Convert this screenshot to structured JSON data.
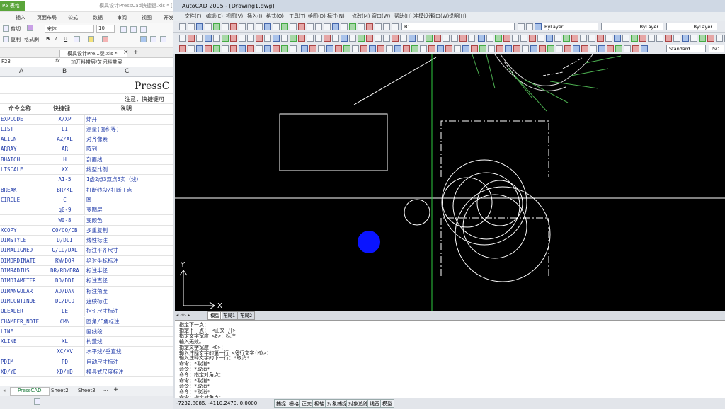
{
  "spreadsheet": {
    "app_label": "P5 表格",
    "doc_title": "模具设计PressCad快捷键.xls * [",
    "ribbon_tabs": [
      "插入",
      "页面布局",
      "公式",
      "数据",
      "审阅",
      "视图",
      "开发"
    ],
    "ribbon": {
      "cut": "剪切",
      "copy": "复制",
      "format_painter": "格式刷",
      "font": "宋体",
      "size": "10",
      "bold": "B",
      "italic": "I",
      "underline": "U"
    },
    "file_tab": "模具设计Pre...键.xls *",
    "cell_ref": "F23",
    "fx": "fx",
    "formula": "加开料带层/关闭料带层",
    "columns": [
      "A",
      "B",
      "C"
    ],
    "title": "PressC",
    "note": "注意，快捷键可",
    "header": [
      "命令全称",
      "快捷键",
      "说明"
    ],
    "rows": [
      [
        "EXPLODE",
        "X/XP",
        "炸开"
      ],
      [
        "LIST",
        "LI",
        "测量(面积等)"
      ],
      [
        "ALIGN",
        "AZ/AL",
        "对齐像素"
      ],
      [
        "ARRAY",
        "AR",
        "阵列"
      ],
      [
        "BHATCH",
        "H",
        "剖面线"
      ],
      [
        "LTSCALE",
        "XX",
        "线型比例"
      ],
      [
        "",
        "A1-5",
        "1虚2点3双点5实（线）"
      ],
      [
        "BREAK",
        "BR/KL",
        "打断线段/打断于点"
      ],
      [
        "CIRCLE",
        "C",
        "圆"
      ],
      [
        "",
        "q0-9",
        "变图层"
      ],
      [
        "",
        "W0-8",
        "变颜色"
      ],
      [
        "XCOPY",
        "CO/CQ/CB",
        "多重复制"
      ],
      [
        "DIMSTYLE",
        "D/DLI",
        "线性标注"
      ],
      [
        "DIMALIGNED",
        "G/LD/DAL",
        "标注平齐尺寸"
      ],
      [
        "DIMORDINATE",
        "RW/DOR",
        "绝对坐标标注"
      ],
      [
        "DIMRADIUS",
        "DR/RD/DRA",
        "标注半径"
      ],
      [
        "DIMDIAMETER",
        "DD/DDI",
        "标注直径"
      ],
      [
        "DIMANGULAR",
        "AD/DAN",
        "标注角度"
      ],
      [
        "DIMCONTINUE",
        "DC/DCO",
        "连续标注"
      ],
      [
        "QLEADER",
        "LE",
        "指引尺寸标注"
      ],
      [
        "CHAMFER_NOTE",
        "CMN",
        "圆角/C角标注"
      ],
      [
        "LINE",
        "L",
        "画线段"
      ],
      [
        "XLINE",
        "XL",
        "构造线"
      ],
      [
        "",
        "XC/XV",
        "水平线/垂直线"
      ],
      [
        "PDIM",
        "PD",
        "自动尺寸标注"
      ],
      [
        "XD/YD",
        "XD/YD",
        "模具式尺度标注"
      ]
    ],
    "sheets": [
      "PressCAD",
      "Sheet2",
      "Sheet3"
    ]
  },
  "autocad": {
    "title": "AutoCAD 2005 - [Drawing1.dwg]",
    "menu": [
      "文件(F)",
      "编辑(E)",
      "视图(V)",
      "插入(I)",
      "格式(O)",
      "工具(T)",
      "绘图(D)",
      "标注(N)",
      "修改(M)",
      "窗口(W)",
      "帮助(H)",
      "冲模设计",
      "窗口(W)",
      "说明(H)"
    ],
    "layer": "B1",
    "bylayer_color": "ByLayer",
    "bylayer_linetype": "ByLayer",
    "bylayer_lineweight": "ByLayer",
    "text_style": "Standard",
    "iso": "ISO",
    "axis_x": "X",
    "axis_y": "Y",
    "layout_tabs": [
      "模型",
      "布局1",
      "布局2"
    ],
    "command_lines": [
      "指定下一点：",
      "指定下一点：  <正交 开>",
      "指定文字宽度 <0>：标注",
      "输入无效。",
      "指定文字宽度 <0>：",
      "输入注释文字的第一行 <多行文字(M)>：",
      "输入注释文字的下一行：*取消*",
      "命令：*取消*",
      "命令：*取消*",
      "命令：指定对角点：",
      "命令：*取消*",
      "命令：*取消*",
      "命令：*取消*",
      "命令：指定对角点：",
      "命令："
    ],
    "coords": "-7232.8086, -4110.2470, 0.0000",
    "status_buttons": [
      "捕捉",
      "栅格",
      "正交",
      "极轴",
      "对象捕捉",
      "对象追踪",
      "线宽",
      "模型"
    ]
  }
}
